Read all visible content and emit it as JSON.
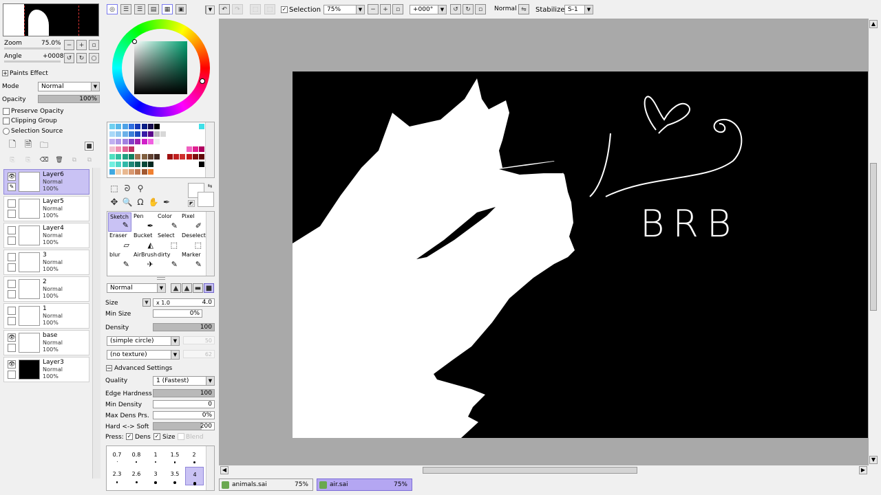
{
  "navigator": {
    "zoom_label": "Zoom",
    "zoom_value": "75.0%",
    "angle_label": "Angle",
    "angle_value": "+0008"
  },
  "layer_panel": {
    "paints_effect_label": "Paints Effect",
    "mode_label": "Mode",
    "mode_value": "Normal",
    "opacity_label": "Opacity",
    "opacity_value": "100%",
    "opacity_level": 1.0,
    "preserve_opacity": "Preserve Opacity",
    "clipping_group": "Clipping Group",
    "selection_source": "Selection Source"
  },
  "layers": [
    {
      "name": "Layer6",
      "mode": "Normal",
      "opacity": "100%",
      "selected": true,
      "visible": true,
      "thumb": "white"
    },
    {
      "name": "Layer5",
      "mode": "Normal",
      "opacity": "100%",
      "selected": false,
      "visible": false,
      "thumb": "white"
    },
    {
      "name": "Layer4",
      "mode": "Normal",
      "opacity": "100%",
      "selected": false,
      "visible": false,
      "thumb": "white"
    },
    {
      "name": "3",
      "mode": "Normal",
      "opacity": "100%",
      "selected": false,
      "visible": false,
      "thumb": "white"
    },
    {
      "name": "2",
      "mode": "Normal",
      "opacity": "100%",
      "selected": false,
      "visible": false,
      "thumb": "white"
    },
    {
      "name": "1",
      "mode": "Normal",
      "opacity": "100%",
      "selected": false,
      "visible": false,
      "thumb": "white"
    },
    {
      "name": "base",
      "mode": "Normal",
      "opacity": "100%",
      "selected": false,
      "visible": true,
      "thumb": "white"
    },
    {
      "name": "Layer3",
      "mode": "Normal",
      "opacity": "100%",
      "selected": false,
      "visible": true,
      "thumb": "black"
    }
  ],
  "toolbar": {
    "selection_label": "Selection",
    "zoom_value": "75%",
    "angle_value": "+000°",
    "blend_mode": "Normal",
    "stabilizer_label": "Stabilizer",
    "stabilizer_value": "S-1"
  },
  "tools": [
    {
      "name": "Sketch",
      "icon": "✎"
    },
    {
      "name": "Pen",
      "icon": "✒"
    },
    {
      "name": "Color",
      "icon": "✎"
    },
    {
      "name": "Pixel",
      "icon": "✐"
    },
    {
      "name": "Eraser",
      "icon": "▱"
    },
    {
      "name": "Bucket",
      "icon": "◭"
    },
    {
      "name": "Select",
      "icon": "⬚"
    },
    {
      "name": "Deselect",
      "icon": "⬚"
    },
    {
      "name": "blur",
      "icon": "✎"
    },
    {
      "name": "AirBrush",
      "icon": "✈"
    },
    {
      "name": "dirty",
      "icon": "✎"
    },
    {
      "name": "Marker",
      "icon": "✎"
    }
  ],
  "tool_settings": {
    "blend_mode": "Normal",
    "size_label": "Size",
    "size_multiplier": "x 1.0",
    "size_value": "4.0",
    "min_size_label": "Min Size",
    "min_size_value": "0%",
    "density_label": "Density",
    "density_value": "100",
    "shape": "(simple circle)",
    "shape_value": "50",
    "texture": "(no texture)",
    "texture_value": "62",
    "advanced_label": "Advanced Settings",
    "quality_label": "Quality",
    "quality_value": "1 (Fastest)",
    "edge_hardness_label": "Edge Hardness",
    "edge_hardness_value": "100",
    "min_density_label": "Min Density",
    "min_density_value": "0",
    "max_dens_label": "Max Dens Prs.",
    "max_dens_value": "0%",
    "hard_soft_label": "Hard <-> Soft",
    "hard_soft_value": "200",
    "press_label": "Press:",
    "dens_label": "Dens",
    "size_check_label": "Size",
    "blend_label": "Blend"
  },
  "brush_sizes": {
    "row1": [
      "0.7",
      "0.8",
      "1",
      "1.5",
      "2"
    ],
    "row2": [
      "2.3",
      "2.6",
      "3",
      "3.5",
      "4"
    ]
  },
  "canvas": {
    "handwriting": "BRB"
  },
  "tabs": [
    {
      "name": "animals.sai",
      "zoom": "75%",
      "active": false
    },
    {
      "name": "air.sai",
      "zoom": "75%",
      "active": true
    }
  ],
  "colors": {
    "selection": "#c9c2f4",
    "tab_active": "#b4a6f2",
    "canvas_bg": "#a9a9a9",
    "panel_bg": "#f0f0f0"
  }
}
